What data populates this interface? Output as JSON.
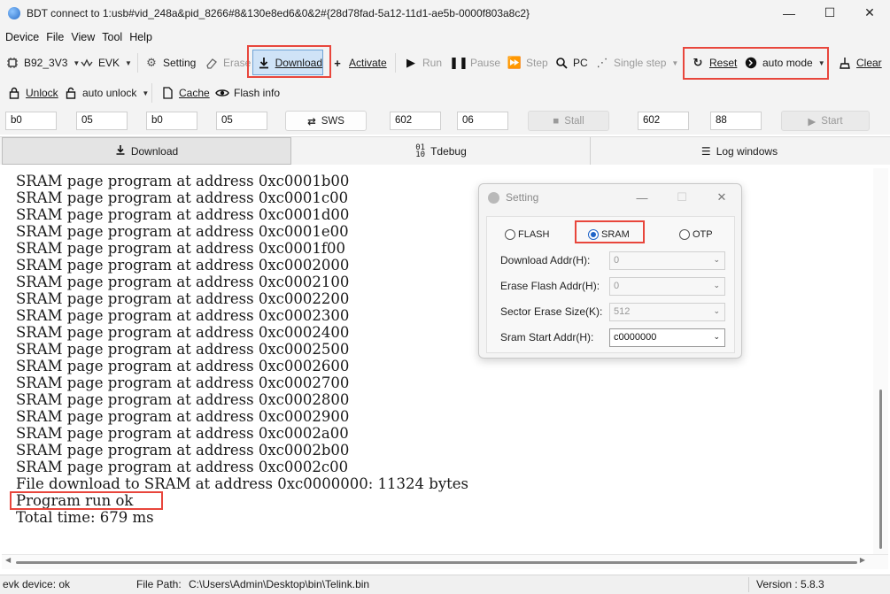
{
  "window": {
    "title": "BDT connect to 1:usb#vid_248a&pid_8266#8&130e8ed6&0&2#{28d78fad-5a12-11d1-ae5b-0000f803a8c2}",
    "minimize_glyph": "—",
    "maximize_glyph": "☐",
    "close_glyph": "✕"
  },
  "menu": [
    "Device",
    "File",
    "View",
    "Tool",
    "Help"
  ],
  "toolbar1": {
    "chip": "B92_3V3",
    "board": "EVK",
    "setting": "Setting",
    "erase": "Erase",
    "download": "Download",
    "activate": "Activate",
    "run": "Run",
    "pause": "Pause",
    "step": "Step",
    "pc": "PC",
    "single_step": "Single step",
    "reset": "Reset",
    "auto_mode": "auto mode",
    "clear": "Clear"
  },
  "toolbar2": {
    "unlock": "Unlock",
    "auto_unlock": "auto unlock",
    "cache": "Cache",
    "flash_info": "Flash info"
  },
  "toolbar3": {
    "fields_a": [
      "b0",
      "05",
      "b0",
      "05"
    ],
    "sws": "SWS",
    "fields_b": [
      "602",
      "06"
    ],
    "stall": "Stall",
    "fields_c": [
      "602",
      "88"
    ],
    "start": "Start"
  },
  "tabs": [
    "Download",
    "Tdebug",
    "Log windows"
  ],
  "log": [
    "SRAM page program at address 0xc0001b00",
    "SRAM page program at address 0xc0001c00",
    "SRAM page program at address 0xc0001d00",
    "SRAM page program at address 0xc0001e00",
    "SRAM page program at address 0xc0001f00",
    "SRAM page program at address 0xc0002000",
    "SRAM page program at address 0xc0002100",
    "SRAM page program at address 0xc0002200",
    "SRAM page program at address 0xc0002300",
    "SRAM page program at address 0xc0002400",
    "SRAM page program at address 0xc0002500",
    "SRAM page program at address 0xc0002600",
    "SRAM page program at address 0xc0002700",
    "SRAM page program at address 0xc0002800",
    "SRAM page program at address 0xc0002900",
    "SRAM page program at address 0xc0002a00",
    "SRAM page program at address 0xc0002b00",
    "SRAM page program at address 0xc0002c00",
    "File download to SRAM at address 0xc0000000: 11324 bytes",
    "Program run ok",
    "Total time: 679 ms"
  ],
  "status": {
    "device": "evk device: ok",
    "path_label": "File Path:",
    "path": "C:\\Users\\Admin\\Desktop\\bin\\Telink.bin",
    "version": "Version : 5.8.3"
  },
  "dialog": {
    "title": "Setting",
    "radios": [
      "FLASH",
      "SRAM",
      "OTP"
    ],
    "selected": "SRAM",
    "rows": [
      {
        "label": "Download  Addr(H):",
        "value": "0"
      },
      {
        "label": "Erase Flash Addr(H):",
        "value": "0"
      },
      {
        "label": "Sector Erase Size(K):",
        "value": "512"
      },
      {
        "label": "Sram Start Addr(H):",
        "value": "c0000000"
      }
    ]
  },
  "colors": {
    "highlight": "#e8463c",
    "accent": "#1e63c7"
  }
}
